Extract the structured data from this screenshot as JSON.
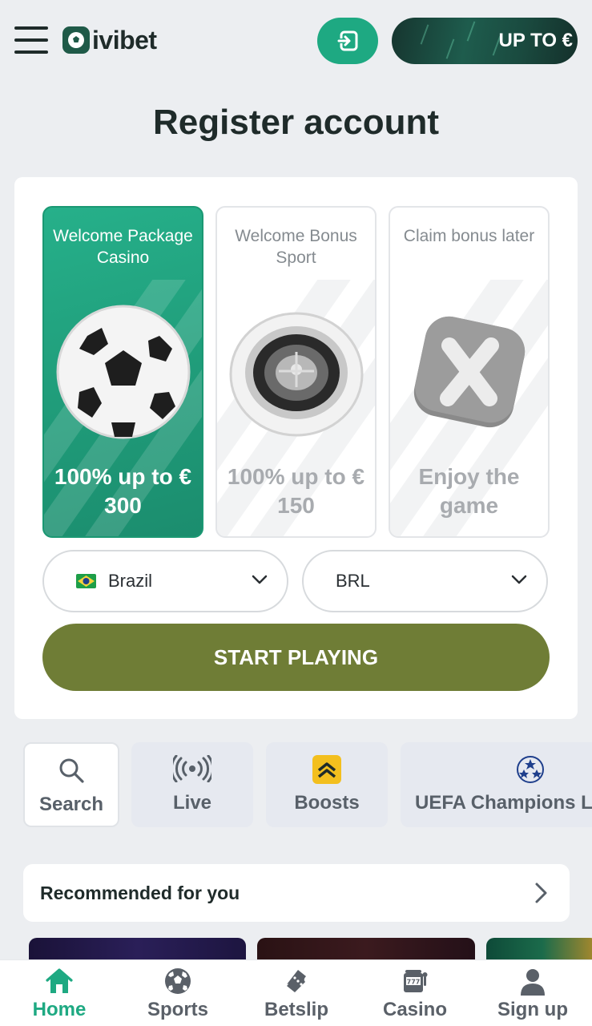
{
  "header": {
    "brand": "ivibet",
    "promo_label": "UP TO €"
  },
  "page": {
    "title": "Register account"
  },
  "bonuses": [
    {
      "title": "Welcome Package Casino",
      "value": "100% up to € 300",
      "selected": true,
      "icon": "soccer-ball-icon"
    },
    {
      "title": "Welcome Bonus Sport",
      "value": "100% up to € 150",
      "selected": false,
      "icon": "roulette-wheel-icon"
    },
    {
      "title": "Claim bonus later",
      "value": "Enjoy the game",
      "selected": false,
      "icon": "x-cross-icon"
    }
  ],
  "form": {
    "country": "Brazil",
    "currency": "BRL",
    "start_label": "START PLAYING"
  },
  "chips": [
    {
      "label": "Search",
      "icon": "search-icon"
    },
    {
      "label": "Live",
      "icon": "live-broadcast-icon"
    },
    {
      "label": "Boosts",
      "icon": "boost-icon"
    },
    {
      "label": "UEFA Champions Le",
      "icon": "champions-league-icon"
    }
  ],
  "recommended": {
    "label": "Recommended for you"
  },
  "nav": [
    {
      "label": "Home",
      "icon": "home-icon",
      "active": true
    },
    {
      "label": "Sports",
      "icon": "soccer-icon",
      "active": false
    },
    {
      "label": "Betslip",
      "icon": "ticket-icon",
      "active": false
    },
    {
      "label": "Casino",
      "icon": "slot-machine-icon",
      "active": false
    },
    {
      "label": "Sign up",
      "icon": "user-icon",
      "active": false
    }
  ],
  "colors": {
    "accent": "#1ea982",
    "start_button": "#6f7d36",
    "background": "#eceef1"
  }
}
